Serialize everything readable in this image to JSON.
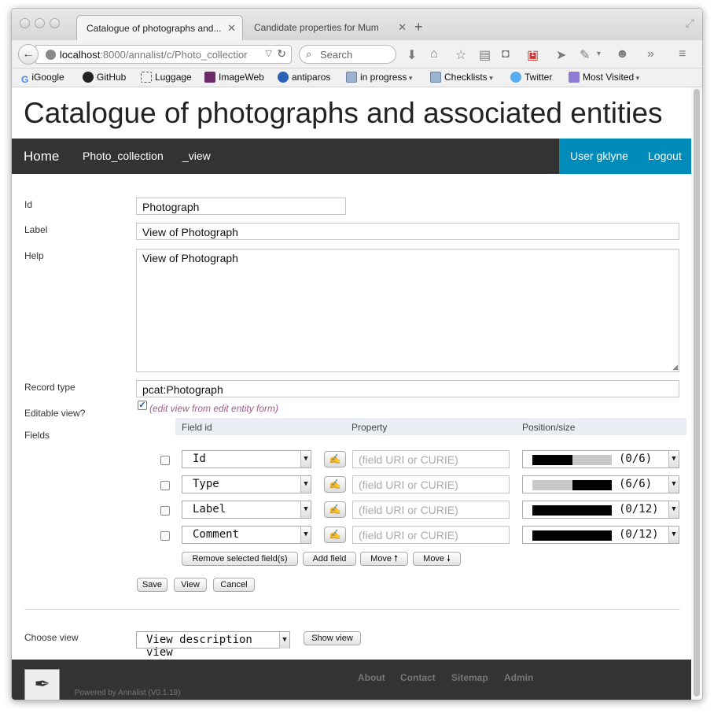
{
  "browser": {
    "tabs": [
      {
        "title": "Catalogue of photographs and...",
        "close": "✕"
      },
      {
        "title": "Candidate properties for Mum",
        "close": "✕"
      }
    ],
    "new_tab": "+",
    "url_host": "localhost",
    "url_rest": ":8000/annalist/c/Photo_collectior",
    "search_placeholder": "Search",
    "badge": "1",
    "bookmarks": [
      {
        "label": "iGoogle",
        "icon": "google-icon"
      },
      {
        "label": "GitHub",
        "icon": "github-icon"
      },
      {
        "label": "Luggage",
        "icon": "dotted-box-icon"
      },
      {
        "label": "ImageWeb",
        "icon": "iw-icon"
      },
      {
        "label": "antiparos",
        "icon": "antiparos-icon"
      },
      {
        "label": "in progress",
        "icon": "folder-icon",
        "dropdown": true
      },
      {
        "label": "Checklists",
        "icon": "folder-icon",
        "dropdown": true
      },
      {
        "label": "Twitter",
        "icon": "twitter-icon"
      },
      {
        "label": "Most Visited",
        "icon": "most-visited-icon",
        "dropdown": true
      }
    ]
  },
  "site": {
    "title": "Catalogue of photographs and associated entities",
    "nav": {
      "home": "Home",
      "collection": "Photo_collection",
      "view": "_view",
      "user": "User gklyne",
      "logout": "Logout"
    }
  },
  "form": {
    "id": {
      "label": "Id",
      "value": "Photograph"
    },
    "label": {
      "label": "Label",
      "value": "View of Photograph"
    },
    "help": {
      "label": "Help",
      "value": "View of Photograph"
    },
    "record_type": {
      "label": "Record type",
      "value": "pcat:Photograph"
    },
    "editable": {
      "label": "Editable view?",
      "checked": true,
      "note": "(edit view from edit entity form)"
    },
    "fields": {
      "label": "Fields",
      "headers": {
        "field_id": "Field id",
        "property": "Property",
        "position": "Position/size"
      },
      "property_placeholder": "(field URI or CURIE)",
      "edit_icon": "✍",
      "rows": [
        {
          "field_id": "Id",
          "position": "(0/6)"
        },
        {
          "field_id": "Type",
          "position": "(6/6)"
        },
        {
          "field_id": "Label",
          "position": "(0/12)"
        },
        {
          "field_id": "Comment",
          "position": "(0/12)"
        }
      ],
      "buttons": {
        "remove": "Remove selected field(s)",
        "add": "Add field",
        "move_up": "Move 🠕",
        "move_down": "Move 🠗"
      }
    },
    "actions": {
      "save": "Save",
      "view": "View",
      "cancel": "Cancel"
    },
    "choose_view": {
      "label": "Choose view",
      "value": "View description view",
      "button": "Show view"
    }
  },
  "footer": {
    "powered": "Powered by Annalist (V0.1.19)",
    "links": [
      "About",
      "Contact",
      "Sitemap",
      "Admin"
    ]
  },
  "colors": {
    "nav_bg": "#333333",
    "accent": "#008cba",
    "note": "#a05c8c"
  }
}
